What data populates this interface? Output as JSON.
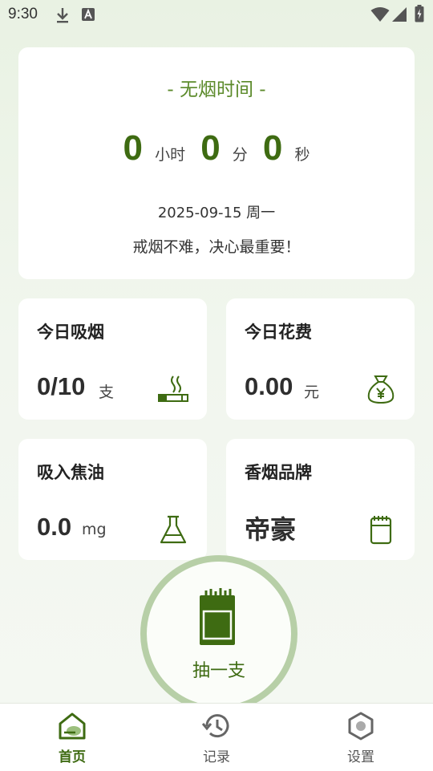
{
  "status_bar": {
    "time": "9:30"
  },
  "timer_card": {
    "title": "- 无烟时间 -",
    "hours": "0",
    "hours_unit": "小时",
    "minutes": "0",
    "minutes_unit": "分",
    "seconds": "0",
    "seconds_unit": "秒",
    "date": "2025-09-15 周一",
    "motto": "戒烟不难，决心最重要！"
  },
  "stats": {
    "today_smoked": {
      "label": "今日吸烟",
      "value": "0/10",
      "unit": "支",
      "icon": "cigarette-icon"
    },
    "today_cost": {
      "label": "今日花费",
      "value": "0.00",
      "unit": "元",
      "icon": "money-bag-icon"
    },
    "tar_intake": {
      "label": "吸入焦油",
      "value": "0.0",
      "unit": "mg",
      "icon": "flask-icon"
    },
    "brand": {
      "label": "香烟品牌",
      "value": "帝豪",
      "icon": "notepad-icon"
    }
  },
  "smoke_button": {
    "label": "抽一支",
    "icon": "cigarette-pack-icon"
  },
  "bottom_nav": [
    {
      "label": "首页",
      "icon": "home-icon",
      "active": true
    },
    {
      "label": "记录",
      "icon": "history-icon",
      "active": false
    },
    {
      "label": "设置",
      "icon": "settings-icon",
      "active": false
    }
  ],
  "colors": {
    "accent": "#3e6b12",
    "accent_light": "#b7cfa7",
    "title_green": "#5b8a2a"
  }
}
